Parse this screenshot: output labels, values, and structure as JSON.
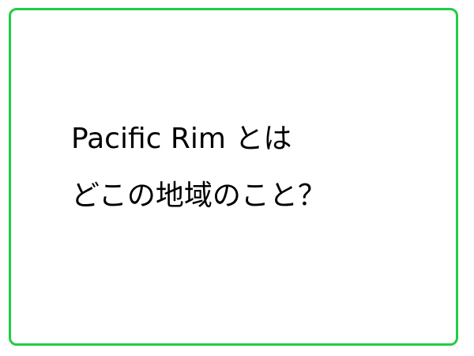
{
  "card": {
    "border_color": "#22cc44",
    "background_color": "#ffffff",
    "text_color": "#000000",
    "line1": "Pacific Rim とは",
    "line2": "どこの地域のこと？"
  }
}
